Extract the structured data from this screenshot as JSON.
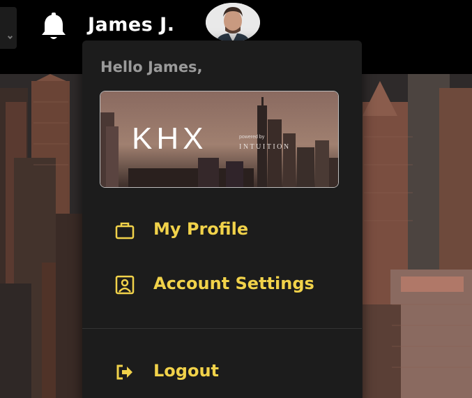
{
  "header": {
    "user_name": "James J.",
    "icons": {
      "notifications": "bell-icon",
      "avatar": "user-avatar-photo",
      "toggle": "chevron-icon"
    }
  },
  "dropdown": {
    "greeting": "Hello James,",
    "banner": {
      "logo_text": "KHX",
      "powered_by": "powered by",
      "brand": "INTUITION"
    },
    "items": [
      {
        "label": "My Profile",
        "icon": "briefcase-icon"
      },
      {
        "label": "Account Settings",
        "icon": "contact-card-icon"
      },
      {
        "label": "Logout",
        "icon": "sign-out-icon"
      }
    ]
  },
  "colors": {
    "accent": "#f1d24a",
    "panel": "#1c1c1c",
    "greeting": "#9a9a9a",
    "topbar": "#000000"
  }
}
